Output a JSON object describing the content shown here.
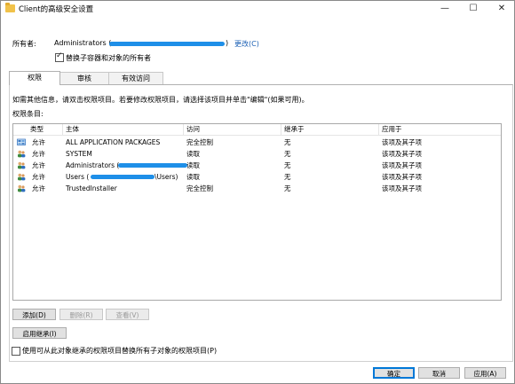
{
  "window": {
    "title": "Client的高级安全设置",
    "min_icon": "—",
    "max_icon": "☐",
    "close_icon": "✕"
  },
  "owner": {
    "label": "所有者:",
    "value": "Administrators (",
    "value_suffix": ")",
    "change_link": "更改(C)",
    "replace_checkbox_label": "替换子容器和对象的所有者",
    "replace_checked": true
  },
  "tabs": [
    {
      "label": "权限",
      "active": true
    },
    {
      "label": "审核",
      "active": false
    },
    {
      "label": "有效访问",
      "active": false
    }
  ],
  "info_text": "如需其他信息，请双击权限项目。若要修改权限项目，请选择该项目并单击\"编辑\"(如果可用)。",
  "entries_label": "权限条目:",
  "table": {
    "columns": [
      "类型",
      "主体",
      "访问",
      "继承于",
      "应用于"
    ],
    "rows": [
      {
        "type": "允许",
        "principal": "ALL APPLICATION PACKAGES",
        "access": "完全控制",
        "inherited": "无",
        "applies": "该项及其子项"
      },
      {
        "type": "允许",
        "principal": "SYSTEM",
        "access": "读取",
        "inherited": "无",
        "applies": "该项及其子项"
      },
      {
        "type": "允许",
        "principal": "Administrators (",
        "access": "读取",
        "inherited": "无",
        "applies": "该项及其子项"
      },
      {
        "type": "允许",
        "principal": "Users (",
        "principal_suffix": "\\Users)",
        "access": "读取",
        "inherited": "无",
        "applies": "该项及其子项"
      },
      {
        "type": "允许",
        "principal": "TrustedInstaller",
        "access": "完全控制",
        "inherited": "无",
        "applies": "该项及其子项"
      }
    ]
  },
  "buttons": {
    "add": "添加(D)",
    "remove": "删除(R)",
    "view": "查看(V)",
    "enable_inheritance": "启用继承(I)",
    "ok": "确定",
    "cancel": "取消",
    "apply": "应用(A)"
  },
  "replace_child_label": "使用可从此对象继承的权限项目替换所有子对象的权限项目(P)",
  "colors": {
    "accent": "#0078d7",
    "redaction": "#1e8fe8",
    "link": "#1a5fb4"
  }
}
